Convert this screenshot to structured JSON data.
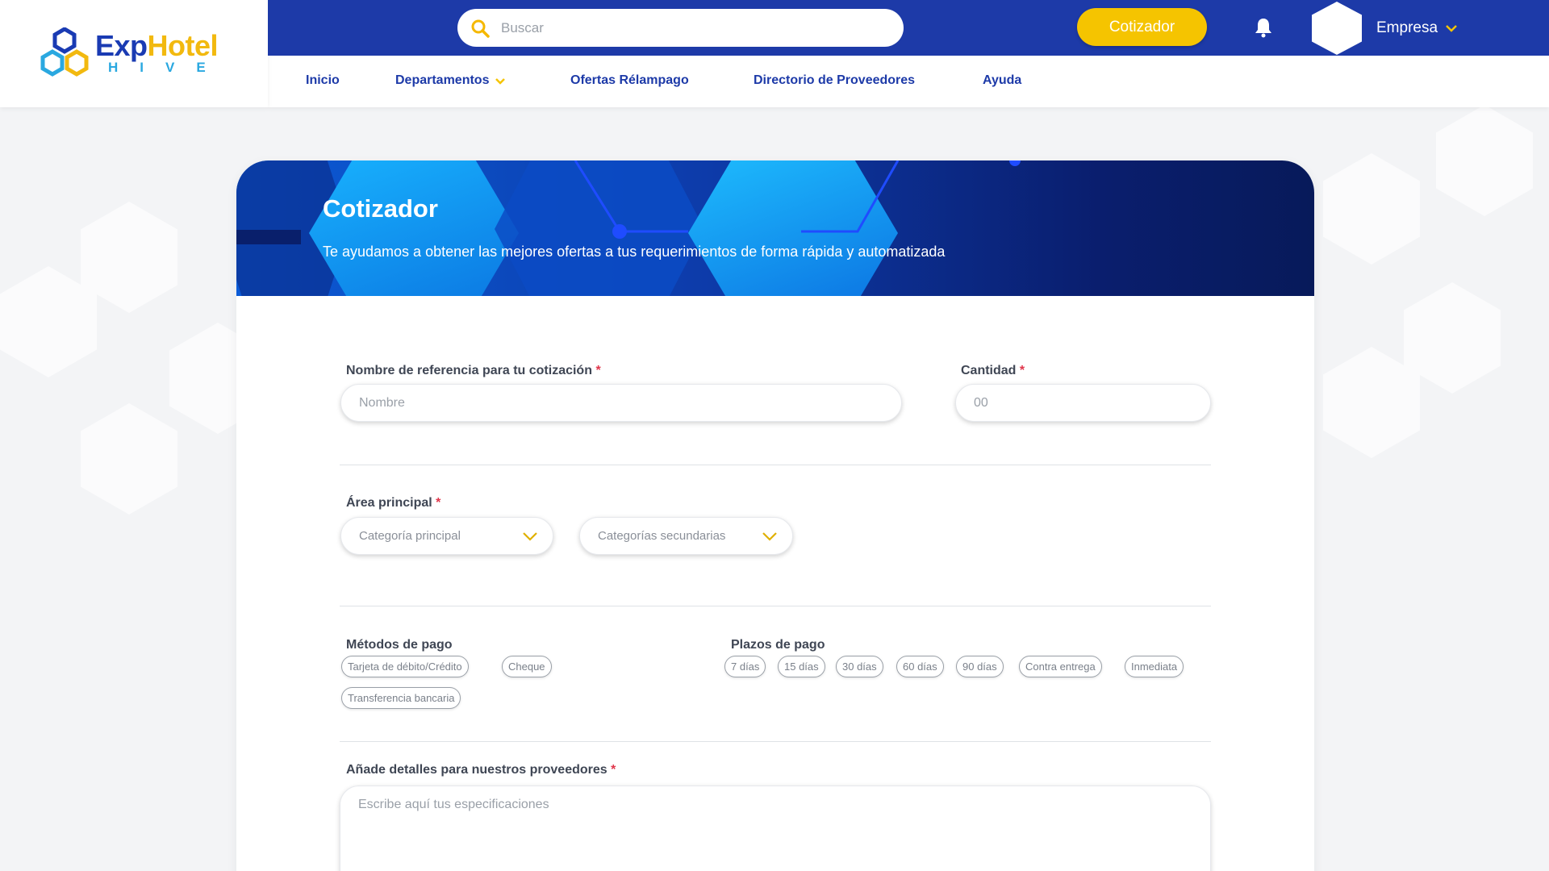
{
  "brand": {
    "name_part1": "Exp",
    "name_part2": "Hotel",
    "sub": "HIVE",
    "colors": {
      "blue": "#1a3bb3",
      "yellow": "#f2b90f",
      "cyan": "#2aa8e0"
    }
  },
  "header": {
    "search_placeholder": "Buscar",
    "cotizador_button": "Cotizador",
    "notifications_icon": "bell-icon",
    "account_label": "Empresa"
  },
  "nav": {
    "items": [
      {
        "label": "Inicio"
      },
      {
        "label": "Departamentos",
        "has_dropdown": true
      },
      {
        "label": "Ofertas Rélampago"
      },
      {
        "label": "Directorio de Proveedores"
      },
      {
        "label": "Ayuda"
      }
    ]
  },
  "banner": {
    "title": "Cotizador",
    "subtitle": "Te ayudamos a obtener las mejores ofertas a tus requerimientos de forma rápida y automatizada"
  },
  "form": {
    "reference_name": {
      "label": "Nombre de referencia para tu cotización",
      "required_mark": "*",
      "placeholder": "Nombre",
      "value": ""
    },
    "quantity": {
      "label": "Cantidad",
      "required_mark": "*",
      "placeholder": "00",
      "value": ""
    },
    "main_area": {
      "label": "Área principal",
      "required_mark": "*",
      "primary_select": "Categoría principal",
      "secondary_select": "Categorías secundarias"
    },
    "payment_methods": {
      "label": "Métodos de pago",
      "options": [
        "Tarjeta de débito/Crédito",
        "Cheque",
        "Transferencia bancaria"
      ]
    },
    "payment_terms": {
      "label": "Plazos de pago",
      "options": [
        "7 días",
        "15 días",
        "30 días",
        "60 días",
        "90 días",
        "Contra entrega",
        "Inmediata"
      ]
    },
    "details": {
      "label": "Añade detalles para nuestros proveedores",
      "required_mark": "*",
      "placeholder": "Escribe aquí tus especificaciones",
      "value": ""
    }
  },
  "colors": {
    "primary": "#1d3aa8",
    "accent": "#f5c400",
    "required": "#e0364b"
  }
}
